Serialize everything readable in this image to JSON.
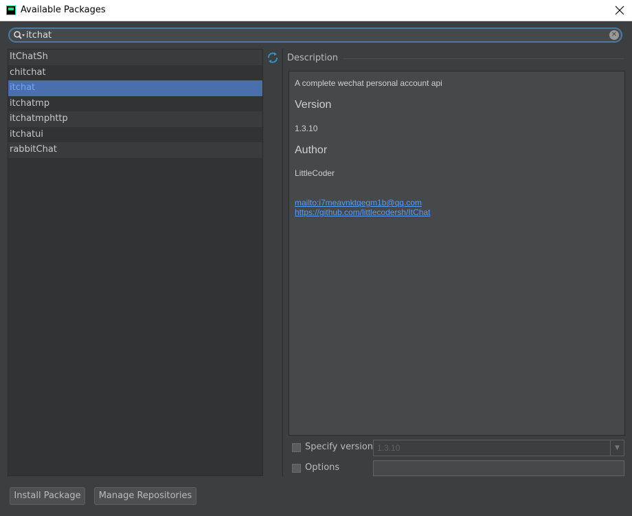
{
  "window": {
    "title": "Available Packages",
    "close_icon": "close-icon"
  },
  "search": {
    "value": "itchat",
    "placeholder": ""
  },
  "packages": [
    {
      "name": "ItChatSh"
    },
    {
      "name": "chitchat"
    },
    {
      "name": "itchat",
      "selected": true
    },
    {
      "name": "itchatmp"
    },
    {
      "name": "itchatmphttp"
    },
    {
      "name": "itchatui"
    },
    {
      "name": "rabbitChat"
    }
  ],
  "description": {
    "legend": "Description",
    "summary": "A complete wechat personal account api",
    "version_heading": "Version",
    "version": "1.3.10",
    "author_heading": "Author",
    "author": "LittleCoder",
    "email_link": "mailto:i7meavnktqegm1b@qq.com",
    "url_link": "https://github.com/littlecodersh/ItChat"
  },
  "options": {
    "specify_version_label": "Specify version",
    "specify_version_checked": false,
    "version_value": "1.3.10",
    "options_label": "Options",
    "options_checked": false,
    "options_value": ""
  },
  "buttons": {
    "install": "Install Package",
    "manage": "Manage Repositories"
  },
  "colors": {
    "background": "#3c3f41",
    "selection": "#4b6eaf",
    "link": "#589df6",
    "search_border": "#4a7ba8"
  }
}
